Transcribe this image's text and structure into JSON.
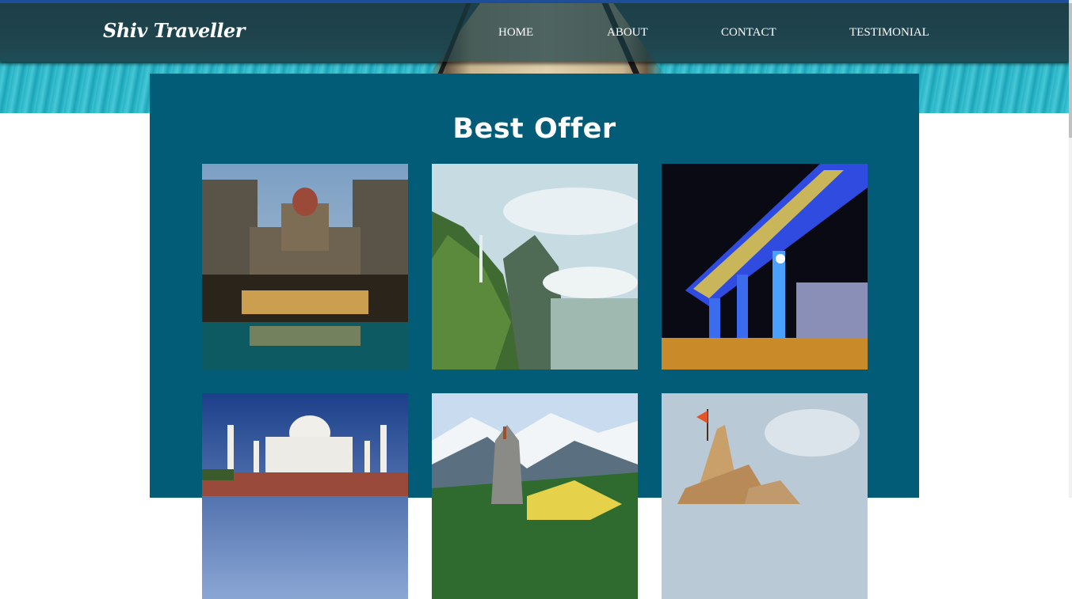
{
  "header": {
    "brand": "Shiv Traveller",
    "nav": [
      {
        "label": "HOME"
      },
      {
        "label": "ABOUT"
      },
      {
        "label": "CONTACT"
      },
      {
        "label": "TESTIMONIAL"
      }
    ]
  },
  "offers": {
    "title": "Best Offer",
    "items": [
      {
        "subject": "palace hotel with pool at night"
      },
      {
        "subject": "green mountain cliffs with clouds"
      },
      {
        "subject": "blue lit flyover at night"
      },
      {
        "subject": "white marble mausoleum"
      },
      {
        "subject": "mountain temple with snowy peaks"
      },
      {
        "subject": "temple spire with flag"
      }
    ]
  },
  "colors": {
    "panel": "#025c78",
    "navbar": "#163a42",
    "text": "#ffffff"
  }
}
